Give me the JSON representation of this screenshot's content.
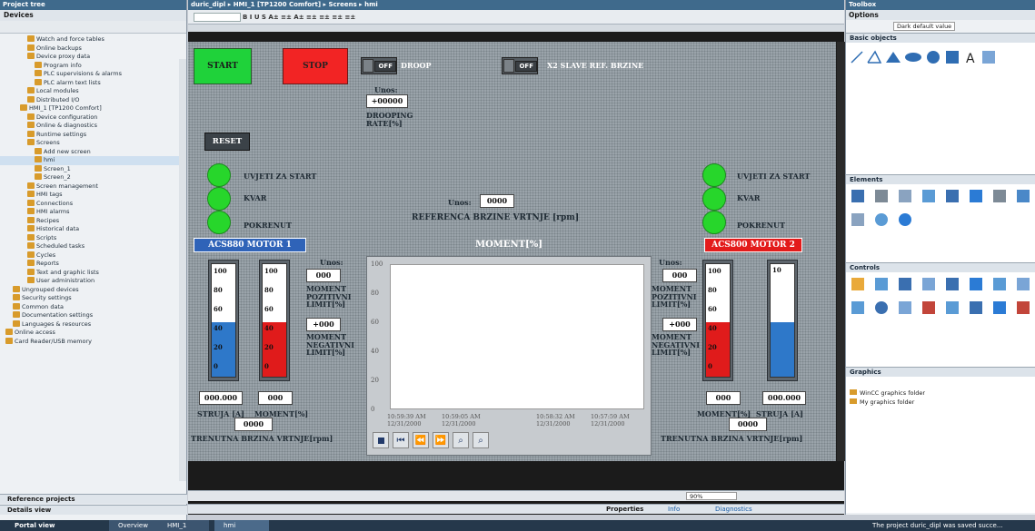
{
  "left_panel": {
    "title": "Project tree",
    "devices_tab": "Devices",
    "tree": [
      "Watch and force tables",
      "Online backups",
      "Device proxy data",
      "Program info",
      "PLC supervisions & alarms",
      "PLC alarm text lists",
      "Local modules",
      "Distributed I/O",
      "HMI_1 [TP1200 Comfort]",
      "Device configuration",
      "Online & diagnostics",
      "Runtime settings",
      "Screens",
      "Add new screen",
      "hmi",
      "Screen_1",
      "Screen_2",
      "Screen management",
      "HMI tags",
      "Connections",
      "HMI alarms",
      "Recipes",
      "Historical data",
      "Scripts",
      "Scheduled tasks",
      "Cycles",
      "Reports",
      "Text and graphic lists",
      "User administration",
      "Ungrouped devices",
      "Security settings",
      "Common data",
      "Documentation settings",
      "Languages & resources",
      "Online access",
      "Card Reader/USB memory"
    ],
    "reference_projects": "Reference projects",
    "details_view": "Details view"
  },
  "breadcrumb": "duric_dipl ▸ HMI_1 [TP1200 Comfort] ▸ Screens ▸ hmi",
  "toolbar_text": "B  I  U  S  A±  ≡±  A±  ≡±  ≡±  ≡±  ≡±",
  "hmi": {
    "start": "START",
    "stop": "STOP",
    "reset": "RESET",
    "off1": "OFF",
    "droop": "DROOP",
    "off2": "OFF",
    "x2_slave": "X2 SLAVE REF. BRZINE",
    "unos_droop": "Unos:",
    "droop_value": "+00000",
    "drooping_rate": "DROOPING RATE[%]",
    "uvjeti_l": "UVJETI ZA START",
    "kvar_l": "KVAR",
    "pokrenut_l": "POKRENUT",
    "uvjeti_r": "UVJETI ZA START",
    "kvar_r": "KVAR",
    "pokrenut_r": "POKRENUT",
    "unos_ref": "Unos:",
    "ref_value": "0000",
    "referenca": "REFERENCA BRZINE VRTNJE [rpm]",
    "motor1": "ACS880 MOTOR 1",
    "motor2": "ACS800 MOTOR 2",
    "moment_title": "MOMENT[%]",
    "unos_l": "Unos:",
    "unos_r": "Unos:",
    "mom_poz_l_val": "000",
    "mom_poz_l_lbl": "MOMENT POZITIVNI LIMIT[%]",
    "mom_neg_l_val": "+000",
    "mom_neg_l_lbl": "MOMENT NEGATIVNI LIMIT[%]",
    "mom_poz_r_val": "000",
    "mom_poz_r_lbl": "MOMENT POZITIVNI LIMIT[%]",
    "mom_neg_r_val": "+000",
    "mom_neg_r_lbl": "MOMENT NEGATIVNI LIMIT[%]",
    "struja_l_val": "000.000",
    "moment_l_val": "000",
    "struja_l_lbl": "STRUJA [A]",
    "moment_l_lbl": "MOMENT[%]",
    "moment_r_val": "000",
    "struja_r_val": "000.000",
    "moment_r_lbl": "MOMENT[%]",
    "struja_r_lbl": "STRUJA [A]",
    "brzina_l_val": "0000",
    "brzina_l_lbl": "TRENUTNA BRZINA VRTNJE[rpm]",
    "brzina_r_val": "0000",
    "brzina_r_lbl": "TRENUTNA BRZINA VRTNJE[rpm]",
    "trend_y": [
      "100",
      "80",
      "60",
      "40",
      "20",
      "0"
    ],
    "trend_x": [
      {
        "t": "10:59:39 AM",
        "d": "12/31/2000"
      },
      {
        "t": "10:59:05 AM",
        "d": "12/31/2000"
      },
      {
        "t": "10:58:32 AM",
        "d": "12/31/2000"
      },
      {
        "t": "10:57:59 AM",
        "d": "12/31/2000"
      }
    ],
    "g1": [
      "100",
      "80",
      "60",
      "40",
      "20",
      "0"
    ],
    "g2": [
      "100",
      "80",
      "60",
      "40",
      "20",
      "0"
    ],
    "g3": [
      "100",
      "80",
      "60",
      "40",
      "20",
      "0"
    ],
    "g4_top": "10"
  },
  "right_panel": {
    "title": "Toolbox",
    "options": "Options",
    "dropdown": "Dark default value",
    "basic_objects": "Basic objects",
    "elements": "Elements",
    "controls": "Controls",
    "graphics": "Graphics",
    "g_folder1": "WinCC graphics folder",
    "g_folder2": "My graphics folder"
  },
  "bottom": {
    "zoom": "90%",
    "properties": "Properties",
    "info": "Info",
    "diagnostics": "Diagnostics",
    "portal_view": "Portal view",
    "overview": "Overview",
    "hmi1": "HMI_1",
    "hmi": "hmi",
    "status": "The project duric_dipl was saved succe..."
  }
}
